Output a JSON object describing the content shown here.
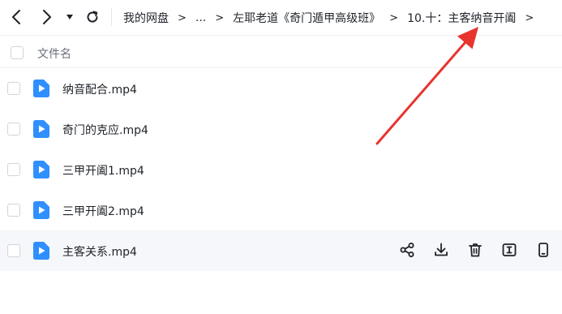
{
  "breadcrumb": {
    "items": [
      "我的网盘",
      "...",
      "左耶老道《奇门遁甲高级班》",
      "10.十：主客纳音开阖"
    ],
    "separator": ">"
  },
  "list_header": {
    "name_label": "文件名"
  },
  "files": [
    {
      "name": "纳音配合.mp4"
    },
    {
      "name": "奇门的克应.mp4"
    },
    {
      "name": "三甲开阖1.mp4"
    },
    {
      "name": "三甲开阖2.mp4"
    },
    {
      "name": "主客关系.mp4"
    }
  ],
  "colors": {
    "accent": "#2f8fff",
    "annotation_arrow": "#e8332f",
    "hover_row": "#f5f7fa"
  },
  "row_actions_icons": [
    "share-icon",
    "download-icon",
    "delete-icon",
    "rename-icon",
    "mobile-icon"
  ]
}
